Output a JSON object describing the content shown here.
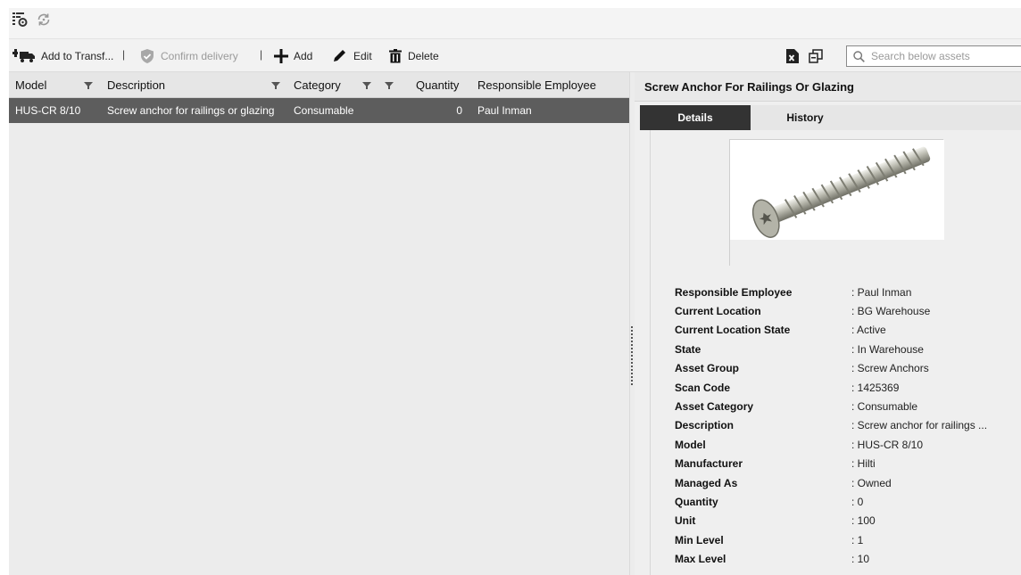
{
  "toolbar": {
    "add_to_transfer": "Add to Transf...",
    "separator": "|",
    "confirm_delivery": "Confirm delivery",
    "add": "Add",
    "edit": "Edit",
    "delete": "Delete",
    "search_placeholder": "Search below assets"
  },
  "grid": {
    "columns": [
      "Model",
      "Description",
      "Category",
      "Quantity",
      "Responsible Employee"
    ],
    "rows": [
      {
        "model": "HUS-CR 8/10",
        "description": "Screw anchor for railings or glazing",
        "category": "Consumable",
        "quantity": "0",
        "employee": "Paul Inman"
      }
    ]
  },
  "detail": {
    "title": "Screw Anchor For Railings Or Glazing",
    "tabs": [
      "Details",
      "History"
    ],
    "properties": [
      {
        "label": "Responsible Employee",
        "value": ": Paul Inman"
      },
      {
        "label": "Current Location",
        "value": ": BG Warehouse"
      },
      {
        "label": "Current Location State",
        "value": ": Active"
      },
      {
        "label": "State",
        "value": ": In Warehouse"
      },
      {
        "label": "Asset Group",
        "value": ": Screw Anchors"
      },
      {
        "label": "Scan Code",
        "value": ": 1425369"
      },
      {
        "label": "Asset Category",
        "value": ": Consumable"
      },
      {
        "label": "Description",
        "value": ": Screw anchor for railings ..."
      },
      {
        "label": "Model",
        "value": ": HUS-CR 8/10"
      },
      {
        "label": "Manufacturer",
        "value": ": Hilti"
      },
      {
        "label": "Managed As",
        "value": ": Owned"
      },
      {
        "label": "Quantity",
        "value": ": 0"
      },
      {
        "label": "Unit",
        "value": ": 100"
      },
      {
        "label": "Min Level",
        "value": ": 1"
      },
      {
        "label": "Max Level",
        "value": ": 10"
      }
    ]
  },
  "colors": {
    "selected_row": "#5d5d5d",
    "active_tab": "#333333"
  }
}
